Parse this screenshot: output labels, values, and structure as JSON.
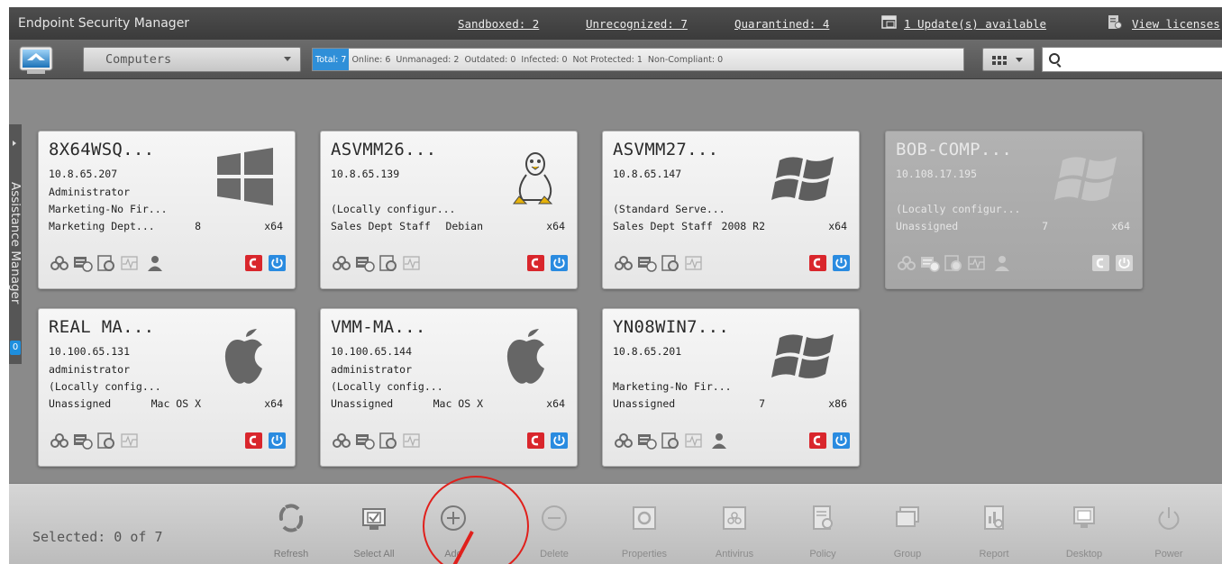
{
  "app": {
    "title": "Endpoint Security Manager"
  },
  "header": {
    "sandboxed": "Sandboxed: 2",
    "unrecognized": "Unrecognized: 7",
    "quarantined": "Quarantined: 4",
    "updates": "1 Update(s) available",
    "licenses": "View licenses"
  },
  "toolbar": {
    "view_selector": "Computers",
    "stats": {
      "total": "Total: 7",
      "online": "Online: 6",
      "unmanaged": "Unmanaged: 2",
      "outdated": "Outdated: 0",
      "infected": "Infected: 0",
      "not_protected": "Not Protected: 1",
      "non_compliant": "Non-Compliant: 0"
    },
    "search": {
      "value": "",
      "placeholder": ""
    }
  },
  "assistance": {
    "label": "Assistance Manager",
    "badge": "0"
  },
  "computers": [
    {
      "name": "8X64WSQ...",
      "ip": "10.8.65.207",
      "user": "Administrator",
      "policy": "Marketing-No Fir...",
      "group": "Marketing Dept...",
      "os": "8",
      "arch": "x64",
      "os_icon": "windows8-icon",
      "status": "online"
    },
    {
      "name": "ASVMM26...",
      "ip": "10.8.65.139",
      "user": "",
      "policy": "(Locally configur...",
      "group": "Sales Dept Staff",
      "os": "Debian",
      "arch": "x64",
      "os_icon": "linux-icon",
      "status": "online"
    },
    {
      "name": "ASVMM27...",
      "ip": "10.8.65.147",
      "user": "",
      "policy": "(Standard Serve...",
      "group": "Sales Dept Staff",
      "os": "2008 R2",
      "arch": "x64",
      "os_icon": "windows-icon",
      "status": "online"
    },
    {
      "name": "BOB-COMP...",
      "ip": "10.108.17.195",
      "user": "",
      "policy": "(Locally configur...",
      "group": "Unassigned",
      "os": "7",
      "arch": "x64",
      "os_icon": "windows-icon",
      "status": "offline"
    },
    {
      "name": "REAL MA...",
      "ip": "10.100.65.131",
      "user": "administrator",
      "policy": "(Locally config...",
      "group": "Unassigned",
      "os": "Mac OS X",
      "arch": "x64",
      "os_icon": "apple-icon",
      "status": "online"
    },
    {
      "name": "VMM-MA...",
      "ip": "10.100.65.144",
      "user": "administrator",
      "policy": "(Locally config...",
      "group": "Unassigned",
      "os": "Mac OS X",
      "arch": "x64",
      "os_icon": "apple-icon",
      "status": "online"
    },
    {
      "name": "YN08WIN7...",
      "ip": "10.8.65.201",
      "user": "",
      "policy": "Marketing-No Fir...",
      "group": "Unassigned",
      "os": "7",
      "arch": "x86",
      "os_icon": "windows-icon",
      "status": "online"
    }
  ],
  "bottombar": {
    "selected": "Selected: 0 of 7",
    "buttons": [
      {
        "label": "Refresh",
        "icon": "refresh-icon",
        "enabled": true
      },
      {
        "label": "Select All",
        "icon": "select-all-icon",
        "enabled": true
      },
      {
        "label": "Add",
        "icon": "add-icon",
        "enabled": true
      },
      {
        "label": "Delete",
        "icon": "delete-icon",
        "enabled": false
      },
      {
        "label": "Properties",
        "icon": "properties-icon",
        "enabled": false
      },
      {
        "label": "Antivirus",
        "icon": "antivirus-icon",
        "enabled": false
      },
      {
        "label": "Policy",
        "icon": "policy-icon",
        "enabled": false
      },
      {
        "label": "Group",
        "icon": "group-icon",
        "enabled": false
      },
      {
        "label": "Report",
        "icon": "report-icon",
        "enabled": false
      },
      {
        "label": "Desktop",
        "icon": "desktop-icon",
        "enabled": false
      },
      {
        "label": "Power",
        "icon": "power-icon",
        "enabled": false
      }
    ]
  },
  "colors": {
    "accent": "#2f8fd8",
    "alert_red": "#d9262c",
    "power_blue": "#2a8be0",
    "annotation": "#e0201c"
  }
}
